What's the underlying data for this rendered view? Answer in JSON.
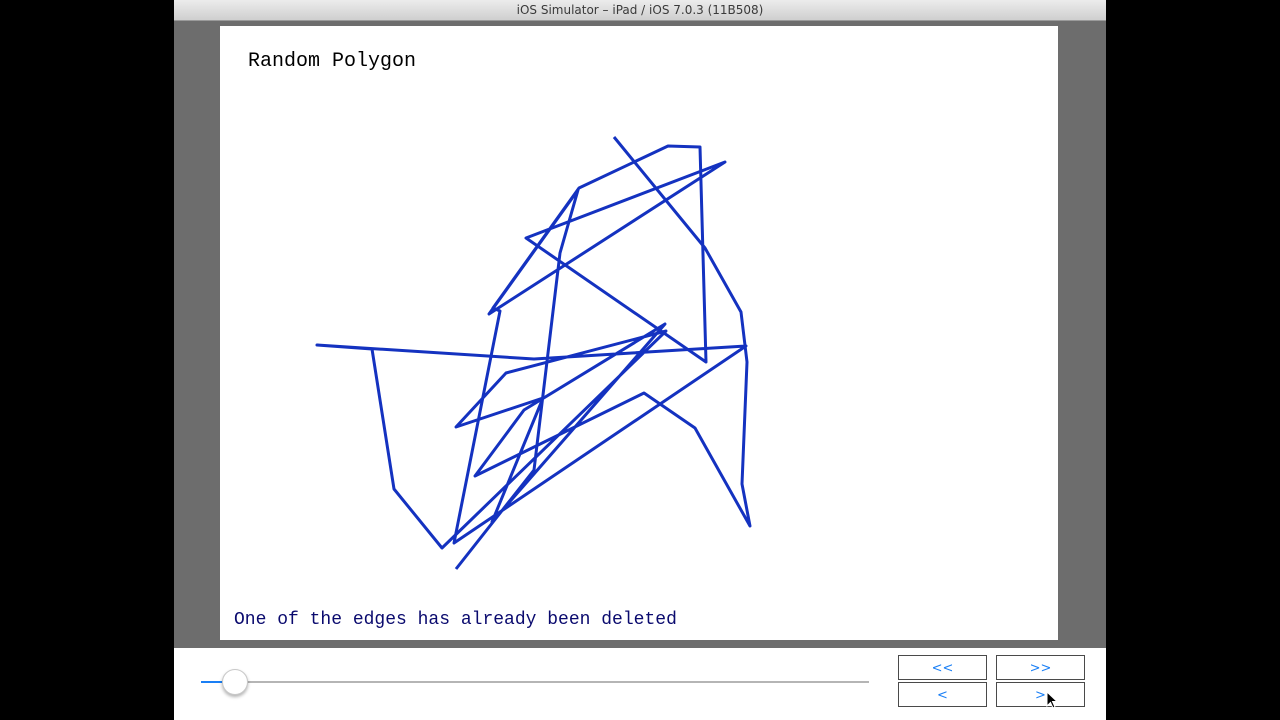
{
  "window": {
    "title": "iOS Simulator – iPad / iOS 7.0.3 (11B508)"
  },
  "canvas": {
    "title": "Random Polygon",
    "status": "One of the edges has already been deleted",
    "line_color": "#1432c0"
  },
  "toolbar": {
    "slider_value": 0.05,
    "buttons": {
      "first": "<<",
      "last": ">>",
      "prev": "<",
      "next": ">"
    }
  },
  "colors": {
    "accent": "#1a7ff5",
    "canvas_bg": "#ffffff",
    "simulator_bg": "#6d6d6d"
  }
}
